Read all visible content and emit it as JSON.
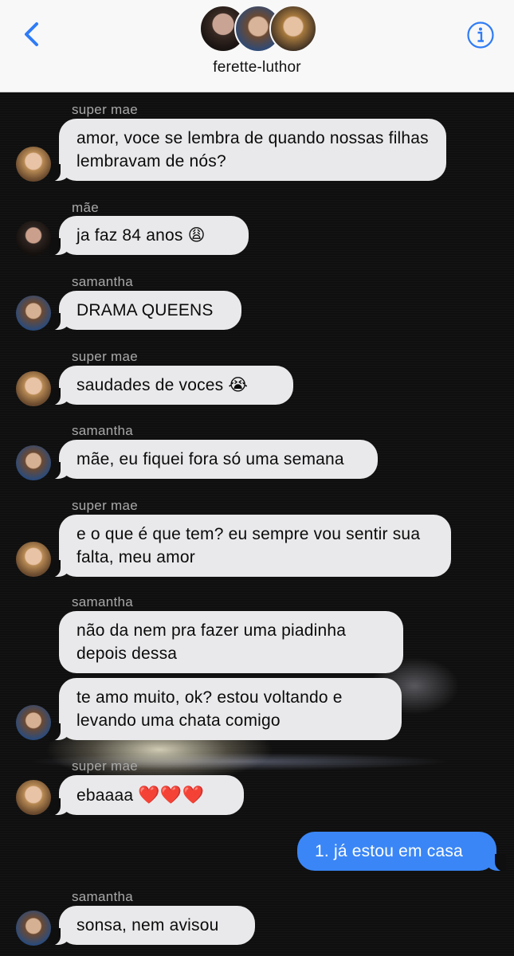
{
  "header": {
    "group_name": "ferette-luthor",
    "back_icon": "chevron-left-icon",
    "info_icon": "info-icon"
  },
  "colors": {
    "accent": "#3a86f6",
    "incoming_bubble": "#e9e9eb",
    "outgoing_bubble": "#3a86f6",
    "background": "#0f0f0f"
  },
  "messages": [
    {
      "sender": "super mae",
      "text": "amor, voce se lembra de quando nossas filhas lembravam de nós?"
    },
    {
      "sender": "mãe",
      "text": "ja faz 84 anos",
      "emoji": "😩"
    },
    {
      "sender": "samantha",
      "text": "DRAMA QUEENS"
    },
    {
      "sender": "super mae",
      "text": "saudades de voces",
      "emoji": "😭"
    },
    {
      "sender": "samantha",
      "text": "mãe, eu fiquei fora só uma semana"
    },
    {
      "sender": "super mae",
      "text": "e o que é que tem? eu sempre vou sentir sua falta, meu amor"
    },
    {
      "sender": "samantha",
      "text": "não da nem pra fazer uma piadinha depois dessa"
    },
    {
      "sender": "samantha",
      "text": "te amo muito, ok? estou voltando e levando uma chata comigo"
    },
    {
      "sender": "super mae",
      "text": "ebaaaa",
      "emoji": "❤️❤️❤️"
    },
    {
      "sender": "",
      "text": "1. já estou em casa",
      "outgoing": true
    },
    {
      "sender": "samantha",
      "text": "sonsa, nem avisou"
    }
  ]
}
